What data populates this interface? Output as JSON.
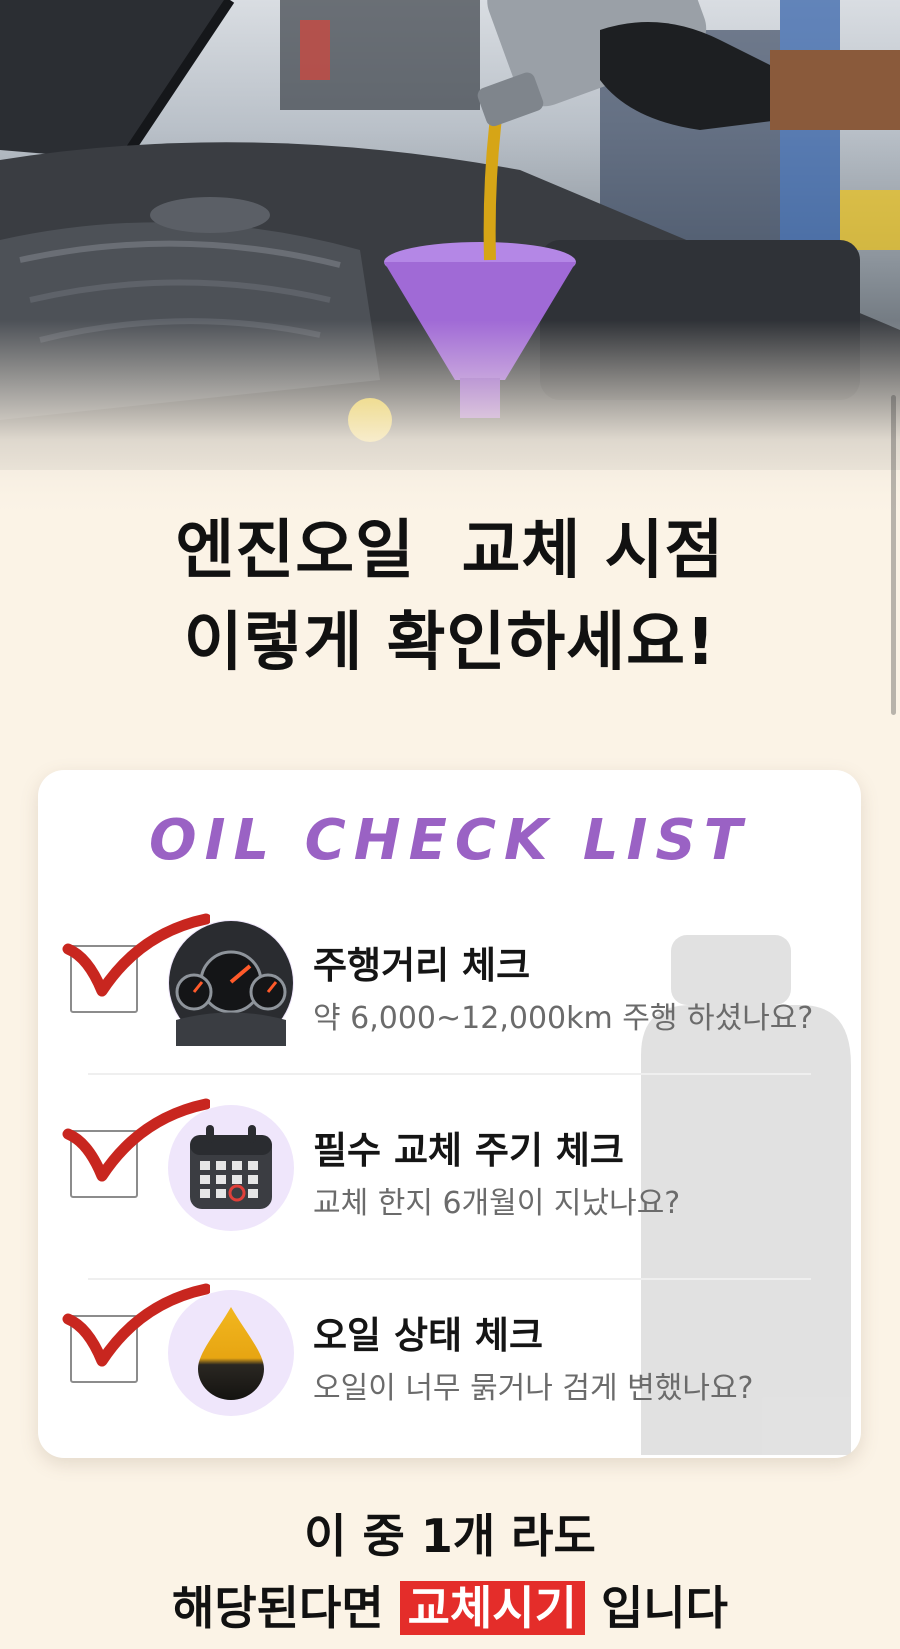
{
  "headline": {
    "line1": "엔진오일  교체 시점",
    "line2": "이렇게 확인하세요!"
  },
  "card": {
    "title": "OIL CHECK LIST",
    "items": [
      {
        "title": "주행거리 체크",
        "desc": "약 6,000~12,000km 주행 하셨나요?",
        "icon": "speedometer-icon",
        "checked": true
      },
      {
        "title": "필수 교체 주기 체크",
        "desc": "교체 한지 6개월이 지났나요?",
        "icon": "calendar-icon",
        "checked": true
      },
      {
        "title": "오일 상태 체크",
        "desc": "오일이 너무 묽거나 검게 변했나요?",
        "icon": "oil-drop-icon",
        "checked": true
      }
    ]
  },
  "footer": {
    "line1": "이 중 1개 라도",
    "line2_before": "해당된다면 ",
    "line2_highlight": "교체시기",
    "line2_after": " 입니다"
  },
  "colors": {
    "background": "#fbf3e6",
    "title_purple": "#9a62c4",
    "check_red": "#c8261f",
    "highlight_red": "#e42d2a",
    "funnel_purple": "#a06ad6"
  }
}
